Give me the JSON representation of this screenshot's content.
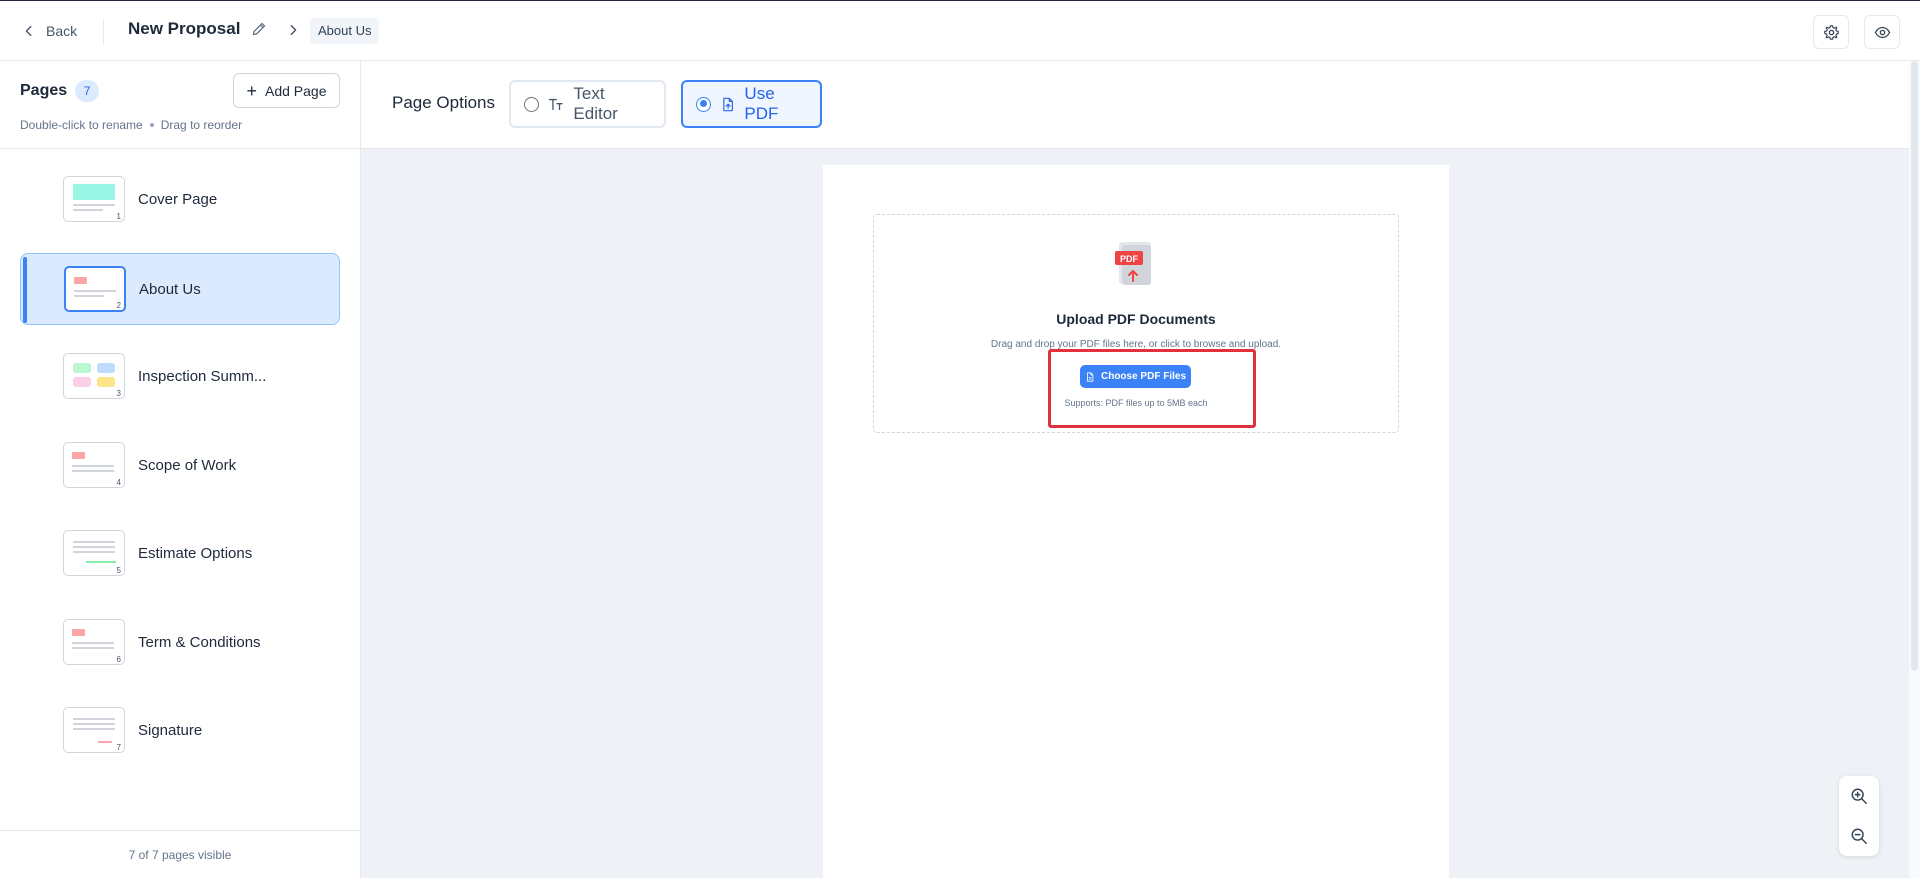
{
  "header": {
    "back_label": "Back",
    "proposal_title": "New Proposal",
    "breadcrumb_current": "About Us"
  },
  "sidebar": {
    "title": "Pages",
    "page_count": "7",
    "add_page_label": "Add Page",
    "hint_rename": "Double-click to rename",
    "hint_reorder": "Drag to reorder",
    "pages": [
      {
        "label": "Cover Page",
        "number": "1"
      },
      {
        "label": "About Us",
        "number": "2"
      },
      {
        "label": "Inspection Summ...",
        "number": "3"
      },
      {
        "label": "Scope of Work",
        "number": "4"
      },
      {
        "label": "Estimate Options",
        "number": "5"
      },
      {
        "label": "Term & Conditions",
        "number": "6"
      },
      {
        "label": "Signature",
        "number": "7"
      }
    ],
    "footer": "7 of 7 pages visible"
  },
  "page_options": {
    "label": "Page Options",
    "options": [
      {
        "label": "Text Editor",
        "selected": false
      },
      {
        "label": "Use PDF",
        "selected": true
      }
    ]
  },
  "upload": {
    "icon_text": "PDF",
    "title": "Upload PDF Documents",
    "description": "Drag and drop your PDF files here, or click to browse and upload.",
    "button_label": "Choose PDF Files",
    "supports": "Supports: PDF files up to 5MB each"
  },
  "colors": {
    "accent": "#3b82f6",
    "highlight": "#e0313c",
    "active_bg": "#dbeafe"
  }
}
